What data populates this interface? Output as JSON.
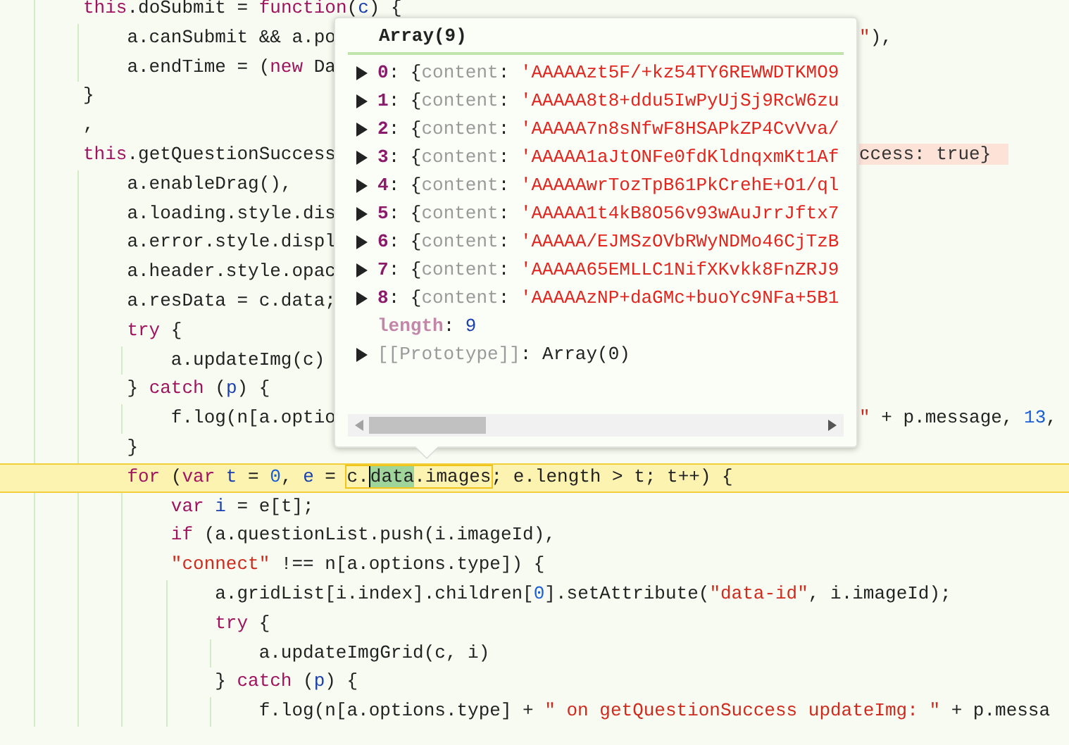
{
  "editor": {
    "lines": [
      {
        "tokens": [
          {
            "kind": "kw",
            "text": "this"
          },
          {
            "kind": "plain",
            "text": ".doSubmit = "
          },
          {
            "kind": "kw",
            "text": "function"
          },
          {
            "kind": "plain",
            "text": "("
          },
          {
            "kind": "var",
            "text": "c"
          },
          {
            "kind": "plain",
            "text": ") {"
          }
        ]
      },
      {
        "tokens": [
          {
            "kind": "plain",
            "text": "    a.canSubmit && a.po"
          }
        ],
        "tail": [
          {
            "kind": "str",
            "text": "\""
          },
          {
            "kind": "plain",
            "text": "),"
          }
        ]
      },
      {
        "tokens": [
          {
            "kind": "plain",
            "text": "    a.endTime = ("
          },
          {
            "kind": "kw",
            "text": "new"
          },
          {
            "kind": "plain",
            "text": " Da"
          }
        ]
      },
      {
        "tokens": [
          {
            "kind": "plain",
            "text": "}"
          }
        ]
      },
      {
        "tokens": [
          {
            "kind": "plain",
            "text": ","
          }
        ]
      },
      {
        "tokens": [
          {
            "kind": "kw",
            "text": "this"
          },
          {
            "kind": "plain",
            "text": ".getQuestionSuccess"
          }
        ],
        "tail": [
          {
            "kind": "annotation",
            "text": "ccess: true}"
          }
        ]
      },
      {
        "tokens": [
          {
            "kind": "plain",
            "text": "    a.enableDrag(),"
          }
        ]
      },
      {
        "tokens": [
          {
            "kind": "plain",
            "text": "    a.loading.style.dis"
          }
        ]
      },
      {
        "tokens": [
          {
            "kind": "plain",
            "text": "    a.error.style.displ"
          }
        ]
      },
      {
        "tokens": [
          {
            "kind": "plain",
            "text": "    a.header.style.opac"
          }
        ]
      },
      {
        "tokens": [
          {
            "kind": "plain",
            "text": "    a.resData = c.data;"
          }
        ]
      },
      {
        "tokens": [
          {
            "kind": "kw",
            "text": "    try"
          },
          {
            "kind": "plain",
            "text": " {"
          }
        ]
      },
      {
        "tokens": [
          {
            "kind": "plain",
            "text": "        a.updateImg(c)"
          }
        ]
      },
      {
        "tokens": [
          {
            "kind": "plain",
            "text": "    } "
          },
          {
            "kind": "kw",
            "text": "catch"
          },
          {
            "kind": "plain",
            "text": " ("
          },
          {
            "kind": "var",
            "text": "p"
          },
          {
            "kind": "plain",
            "text": ") {"
          }
        ]
      },
      {
        "tokens": [
          {
            "kind": "plain",
            "text": "        f.log(n[a.optio"
          }
        ],
        "tail": [
          {
            "kind": "str",
            "text": "\""
          },
          {
            "kind": "plain",
            "text": " + p.message, "
          },
          {
            "kind": "num",
            "text": "13"
          },
          {
            "kind": "plain",
            "text": ","
          }
        ]
      },
      {
        "tokens": [
          {
            "kind": "plain",
            "text": "    }"
          }
        ]
      },
      {
        "current": true,
        "tokens": [
          {
            "kind": "kw",
            "text": "    for"
          },
          {
            "kind": "plain",
            "text": " ("
          },
          {
            "kind": "kw",
            "text": "var"
          },
          {
            "kind": "var",
            "text": " t"
          },
          {
            "kind": "plain",
            "text": " = "
          },
          {
            "kind": "num",
            "text": "0"
          },
          {
            "kind": "plain",
            "text": ", "
          },
          {
            "kind": "var",
            "text": "e"
          },
          {
            "kind": "plain",
            "text": " = "
          },
          {
            "kind": "inspected",
            "parts": [
              {
                "text": "c.",
                "selected": false
              },
              {
                "text": "data",
                "selected": true
              },
              {
                "text": ".images",
                "selected": false
              }
            ]
          },
          {
            "kind": "plain",
            "text": "; e.length > t; t++) {"
          }
        ]
      },
      {
        "tokens": [
          {
            "kind": "kw",
            "text": "        var"
          },
          {
            "kind": "var",
            "text": " i"
          },
          {
            "kind": "plain",
            "text": " = e[t];"
          }
        ]
      },
      {
        "tokens": [
          {
            "kind": "kw",
            "text": "        if"
          },
          {
            "kind": "plain",
            "text": " (a.questionList.push(i.imageId),"
          }
        ]
      },
      {
        "tokens": [
          {
            "kind": "str",
            "text": "        \"connect\""
          },
          {
            "kind": "plain",
            "text": " !== n[a.options.type]) {"
          }
        ]
      },
      {
        "tokens": [
          {
            "kind": "plain",
            "text": "            a.gridList[i.index].children["
          },
          {
            "kind": "num",
            "text": "0"
          },
          {
            "kind": "plain",
            "text": "].setAttribute("
          },
          {
            "kind": "str",
            "text": "\"data-id\""
          },
          {
            "kind": "plain",
            "text": ", i.imageId);"
          }
        ]
      },
      {
        "tokens": [
          {
            "kind": "kw",
            "text": "            try"
          },
          {
            "kind": "plain",
            "text": " {"
          }
        ]
      },
      {
        "tokens": [
          {
            "kind": "plain",
            "text": "                a.updateImgGrid(c, i)"
          }
        ]
      },
      {
        "tokens": [
          {
            "kind": "plain",
            "text": "            } "
          },
          {
            "kind": "kw",
            "text": "catch"
          },
          {
            "kind": "plain",
            "text": " ("
          },
          {
            "kind": "var",
            "text": "p"
          },
          {
            "kind": "plain",
            "text": ") {"
          }
        ]
      },
      {
        "tokens": [
          {
            "kind": "plain",
            "text": "                f.log(n[a.options.type] + "
          },
          {
            "kind": "str",
            "text": "\" on getQuestionSuccess updateImg: \""
          },
          {
            "kind": "plain",
            "text": " + p.messa"
          }
        ]
      }
    ]
  },
  "popover": {
    "title": "Array(9)",
    "rows": [
      {
        "expandable": true,
        "tokens": [
          {
            "kind": "index",
            "text": "0"
          },
          {
            "kind": "plain",
            "text": ": {"
          },
          {
            "kind": "dim",
            "text": "content"
          },
          {
            "kind": "plain",
            "text": ": "
          },
          {
            "kind": "str",
            "text": "'AAAAAzt5F/+kz54TY6REWWDTKMO9"
          }
        ]
      },
      {
        "expandable": true,
        "tokens": [
          {
            "kind": "index",
            "text": "1"
          },
          {
            "kind": "plain",
            "text": ": {"
          },
          {
            "kind": "dim",
            "text": "content"
          },
          {
            "kind": "plain",
            "text": ": "
          },
          {
            "kind": "str",
            "text": "'AAAAA8t8+ddu5IwPyUjSj9RcW6zu"
          }
        ]
      },
      {
        "expandable": true,
        "tokens": [
          {
            "kind": "index",
            "text": "2"
          },
          {
            "kind": "plain",
            "text": ": {"
          },
          {
            "kind": "dim",
            "text": "content"
          },
          {
            "kind": "plain",
            "text": ": "
          },
          {
            "kind": "str",
            "text": "'AAAAA7n8sNfwF8HSAPkZP4CvVva/"
          }
        ]
      },
      {
        "expandable": true,
        "tokens": [
          {
            "kind": "index",
            "text": "3"
          },
          {
            "kind": "plain",
            "text": ": {"
          },
          {
            "kind": "dim",
            "text": "content"
          },
          {
            "kind": "plain",
            "text": ": "
          },
          {
            "kind": "str",
            "text": "'AAAAA1aJtONFe0fdKldnqxmKt1Af"
          }
        ]
      },
      {
        "expandable": true,
        "tokens": [
          {
            "kind": "index",
            "text": "4"
          },
          {
            "kind": "plain",
            "text": ": {"
          },
          {
            "kind": "dim",
            "text": "content"
          },
          {
            "kind": "plain",
            "text": ": "
          },
          {
            "kind": "str",
            "text": "'AAAAAwrTozTpB61PkCrehE+O1/ql"
          }
        ]
      },
      {
        "expandable": true,
        "tokens": [
          {
            "kind": "index",
            "text": "5"
          },
          {
            "kind": "plain",
            "text": ": {"
          },
          {
            "kind": "dim",
            "text": "content"
          },
          {
            "kind": "plain",
            "text": ": "
          },
          {
            "kind": "str",
            "text": "'AAAAA1t4kB8O56v93wAuJrrJftx7"
          }
        ]
      },
      {
        "expandable": true,
        "tokens": [
          {
            "kind": "index",
            "text": "6"
          },
          {
            "kind": "plain",
            "text": ": {"
          },
          {
            "kind": "dim",
            "text": "content"
          },
          {
            "kind": "plain",
            "text": ": "
          },
          {
            "kind": "str",
            "text": "'AAAAA/EJMSzOVbRWyNDMo46CjTzB"
          }
        ]
      },
      {
        "expandable": true,
        "tokens": [
          {
            "kind": "index",
            "text": "7"
          },
          {
            "kind": "plain",
            "text": ": {"
          },
          {
            "kind": "dim",
            "text": "content"
          },
          {
            "kind": "plain",
            "text": ": "
          },
          {
            "kind": "str",
            "text": "'AAAAA65EMLLC1NifXKvkk8FnZRJ9"
          }
        ]
      },
      {
        "expandable": true,
        "tokens": [
          {
            "kind": "index",
            "text": "8"
          },
          {
            "kind": "plain",
            "text": ": {"
          },
          {
            "kind": "dim",
            "text": "content"
          },
          {
            "kind": "plain",
            "text": ": "
          },
          {
            "kind": "str",
            "text": "'AAAAAzNP+daGMc+buoYc9NFa+5B1"
          }
        ]
      },
      {
        "expandable": false,
        "tokens": [
          {
            "kind": "prop",
            "text": "length"
          },
          {
            "kind": "plain",
            "text": ": "
          },
          {
            "kind": "num",
            "text": "9"
          }
        ]
      },
      {
        "expandable": true,
        "tokens": [
          {
            "kind": "dim",
            "text": "[[Prototype]]"
          },
          {
            "kind": "plain",
            "text": ": Array(0)"
          }
        ]
      }
    ]
  }
}
